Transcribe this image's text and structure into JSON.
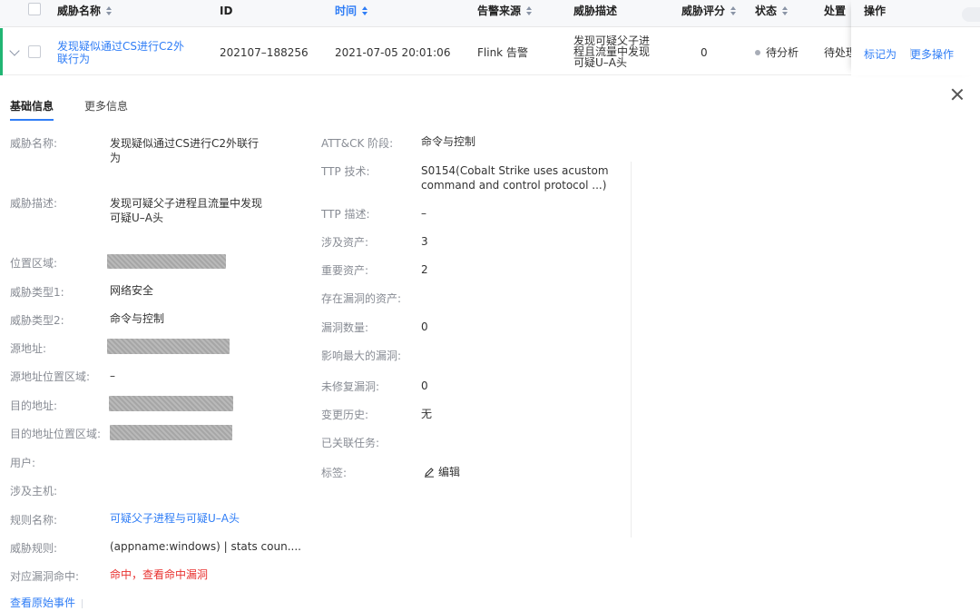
{
  "table": {
    "columns": {
      "name": "威胁名称",
      "id": "ID",
      "time": "时间",
      "source": "告警来源",
      "desc": "威胁描述",
      "score": "威胁评分",
      "status": "状态",
      "handle": "处置",
      "ops": "操作"
    },
    "row": {
      "name_l1": "发现疑似通过CS进行C2外",
      "name_l2": "联行为",
      "id": "202107–188256",
      "time": "2021-07-05 20:01:06",
      "source": "Flink 告警",
      "desc_l1": "发现可疑父子进",
      "desc_l2": "程且流量中发现",
      "desc_l3": "可疑U–A头",
      "score": "0",
      "status": "待分析",
      "handle": "待处理",
      "op_mark": "标记为",
      "op_more": "更多操作"
    }
  },
  "detail": {
    "tabs": {
      "basic": "基础信息",
      "more": "更多信息"
    },
    "left": {
      "name_label": "威胁名称:",
      "name_l1": "发现疑似通过CS进行C2外联行",
      "name_l2": "为",
      "desc_label": "威胁描述:",
      "desc_l1": "发现可疑父子进程且流量中发现",
      "desc_l2": "可疑U–A头",
      "region_label": "位置区域:",
      "type1_label": "威胁类型1:",
      "type1_value": "网络安全",
      "type2_label": "威胁类型2:",
      "type2_value": "命令与控制",
      "src_label": "源地址:",
      "src_region_label": "源地址位置区域:",
      "src_region_value": "–",
      "dst_label": "目的地址:",
      "dst_region_label": "目的地址位置区域:",
      "user_label": "用户:",
      "host_label": "涉及主机:",
      "rule_label": "规则名称:",
      "rule_value": "可疑父子进程与可疑U–A头",
      "threat_rule_label": "威胁规则:",
      "threat_rule_value": "(appname:windows) | stats coun....",
      "vuln_hit_label": "对应漏洞命中:",
      "vuln_hit_value": "命中，查看命中漏洞",
      "view_events": "查看原始事件"
    },
    "right": {
      "attck_label": "ATT&CK 阶段:",
      "attck_value": "命令与控制",
      "ttp_label": "TTP 技术:",
      "ttp_l1": "S0154(Cobalt Strike uses acustom",
      "ttp_l2": "command and control protocol ...)",
      "ttp_desc_label": "TTP 描述:",
      "ttp_desc_value": "–",
      "assets_label": "涉及资产:",
      "assets_value": "3",
      "key_assets_label": "重要资产:",
      "key_assets_value": "2",
      "vuln_assets_label": "存在漏洞的资产:",
      "vuln_count_label": "漏洞数量:",
      "vuln_count_value": "0",
      "max_vuln_label": "影响最大的漏洞:",
      "unfixed_label": "未修复漏洞:",
      "unfixed_value": "0",
      "history_label": "变更历史:",
      "history_value": "无",
      "tasks_label": "已关联任务:",
      "tags_label": "标签:",
      "edit_label": "编辑"
    }
  },
  "colors": {
    "accent": "#2f7df6",
    "alert": "#e8312f",
    "row_marker": "#21b573"
  }
}
